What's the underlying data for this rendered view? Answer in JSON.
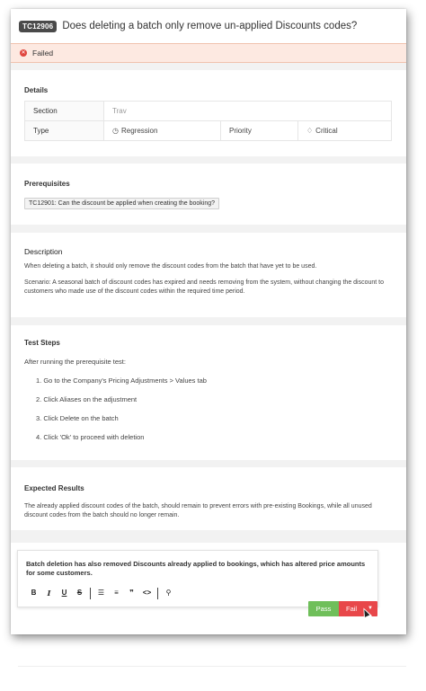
{
  "header": {
    "badge": "TC12906",
    "title": "Does deleting a batch only remove un-applied Discounts codes?"
  },
  "status": {
    "icon": "x-circle-icon",
    "label": "Failed",
    "color": "#e0453e"
  },
  "details": {
    "title": "Details",
    "section_label": "Section",
    "section_value": "Trav",
    "type_label": "Type",
    "type_icon": "clock-icon",
    "type_value": "Regression",
    "priority_label": "Priority",
    "priority_icon": "flame-icon",
    "priority_value": "Critical"
  },
  "prerequisites": {
    "title": "Prerequisites",
    "item": "TC12901: Can the discount be applied when creating the booking?"
  },
  "description": {
    "title": "Description",
    "p1": "When deleting a batch, it should only remove the discount codes from the batch that have yet to be used.",
    "p2": "Scenario: A seasonal batch of discount codes has expired and needs removing from the system, without changing the discount to customers who made use of the discount codes within the required time period."
  },
  "test_steps": {
    "title": "Test Steps",
    "intro": "After running the prerequisite test:",
    "steps": [
      "1. Go to the Company's Pricing Adjustments > Values tab",
      "2. Click Aliases on the adjustment",
      "3. Click Delete on the batch",
      "4. Click 'Ok' to proceed with deletion"
    ]
  },
  "expected_results": {
    "title": "Expected Results",
    "text": "The already applied discount codes of the batch, should remain to prevent errors with pre-existing Bookings, while all unused discount codes from the batch should no longer remain."
  },
  "comment": {
    "text": "Batch deletion has also removed Discounts already applied to bookings, which has altered price amounts for some customers.",
    "toolbar": [
      "B",
      "I",
      "U",
      "S",
      "ordered-list-icon",
      "bullet-list-icon",
      "quote-icon",
      "code-icon",
      "link-icon"
    ]
  },
  "actions": {
    "pass_label": "Pass",
    "fail_label": "Fail",
    "pass_color": "#6fbf5a",
    "fail_color": "#e8474a"
  }
}
